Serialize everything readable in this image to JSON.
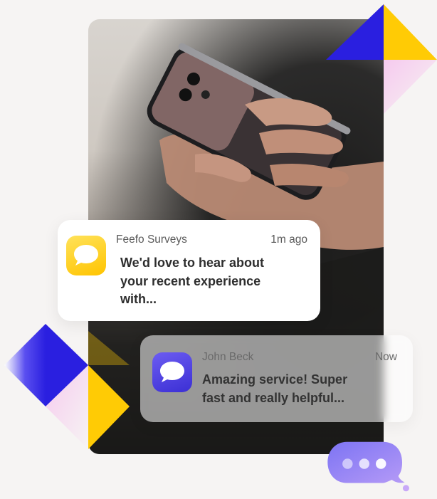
{
  "notifications": [
    {
      "sender": "Feefo Surveys",
      "time": "1m ago",
      "message": "We'd love to hear about your recent experience with...",
      "icon": "chat-bubble-icon",
      "icon_color": "#ffd21f"
    },
    {
      "sender": "John Beck",
      "time": "Now",
      "message": "Amazing service! Super fast and really helpful...",
      "icon": "chat-bubble-icon",
      "icon_color": "#4a3de0"
    }
  ],
  "colors": {
    "blue": "#2a1fe0",
    "yellow": "#ffcb05",
    "pink": "#f7c6ec",
    "purple": "#9a7af5"
  }
}
